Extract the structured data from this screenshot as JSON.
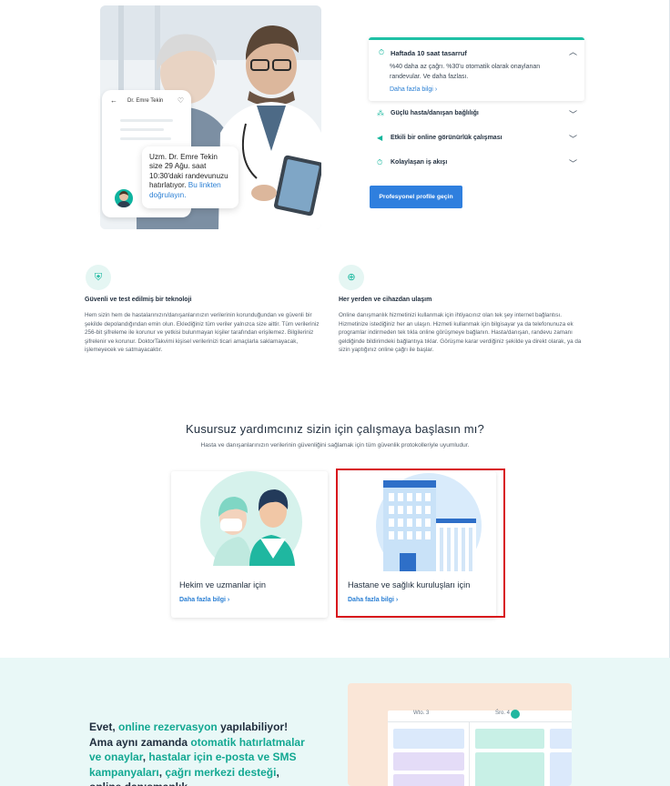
{
  "hero": {
    "phone_doctor_name": "Dr. Emre Tekin",
    "bubble_text": "Uzm. Dr. Emre Tekin size 29 Ağu. saat 10:30'daki randevunuzu hatırlatıyor. ",
    "bubble_link": "Bu linkten doğrulayın."
  },
  "accordion": {
    "open_item": {
      "title": "Haftada 10 saat tasarruf",
      "description": "%40 daha az çağrı. %30'u otomatik olarak onaylanan randevular. Ve daha fazlası.",
      "more_link": "Daha fazla bilgi",
      "icon": "clock-icon"
    },
    "items": [
      {
        "title": "Güçlü hasta/danışan bağlılığı",
        "icon": "people-icon"
      },
      {
        "title": "Etkili bir online görünürlük çalışması",
        "icon": "megaphone-icon"
      },
      {
        "title": "Kolaylaşan iş akışı",
        "icon": "clock-icon"
      }
    ],
    "cta_label": "Profesyonel profile geçin"
  },
  "features": [
    {
      "title": "Güvenli ve test edilmiş bir teknoloji",
      "body": "Hem sizin hem de hastalarınızın/danışanlarınızın verilerinin korunduğundan ve güvenli bir şekilde depolandığından emin olun. Eklediğiniz tüm veriler yalnızca size aittir. Tüm verileriniz 256-bit şifreleme ile korunur ve yetkisi bulunmayan kişiler tarafından erişilemez. Bilgileriniz şifrelenir ve korunur. DoktorTakvimi kişisel verilerinizi ticari amaçlarla saklamayacak, işlemeyecek ve satmayacaktır.",
      "icon": "shield-icon"
    },
    {
      "title": "Her yerden ve cihazdan ulaşım",
      "body": "Online danışmanlık hizmetinizi kullanmak için ihtiyacınız olan tek şey internet bağlantısı. Hizmetinize istediğiniz her an ulaşın. Hizmeti kullanmak için bilgisayar ya da telefonunuza ek programlar indirmeden tek tıkla online görüşmeye bağlanın. Hasta/danışan, randevu zamanı geldiğinde bildirimdeki bağlantıya tıklar. Görüşme karar verdiğiniz şekilde ya direkt olarak, ya da sizin yaptığınız online çağrı ile başlar.",
      "icon": "globe-icon"
    }
  ],
  "section": {
    "title": "Kusursuz yardımcınız sizin için çalışmaya başlasın mı?",
    "subtitle": "Hasta ve danışanlarınızın verilerinin güvenliğini sağlamak için tüm güvenlik protokolleriyle uyumludur."
  },
  "cards": [
    {
      "title": "Hekim ve uzmanlar için",
      "link": "Daha fazla bilgi"
    },
    {
      "title": "Hastane ve sağlık kuruluşları için",
      "link": "Daha fazla bilgi"
    }
  ],
  "band": {
    "t1": "Evet, ",
    "h1": "online rezervasyon",
    "t2": " yapılabiliyor! Ama aynı zamanda ",
    "h2": "otomatik hatırlatmalar ve onaylar",
    "t3": ", ",
    "h3": "hastalar için e-posta ve SMS kampanyaları",
    "t4": ", ",
    "h4": "çağrı merkezi desteği",
    "t5": ", online danışmanlık",
    "calendar_days": [
      "Wto. 3",
      "Śro. 4"
    ]
  },
  "colors": {
    "accent": "#13b69c",
    "link": "#2a7fd4",
    "cta": "#2f7fde",
    "highlight": "#d8151c",
    "band": "#e9f8f7"
  }
}
